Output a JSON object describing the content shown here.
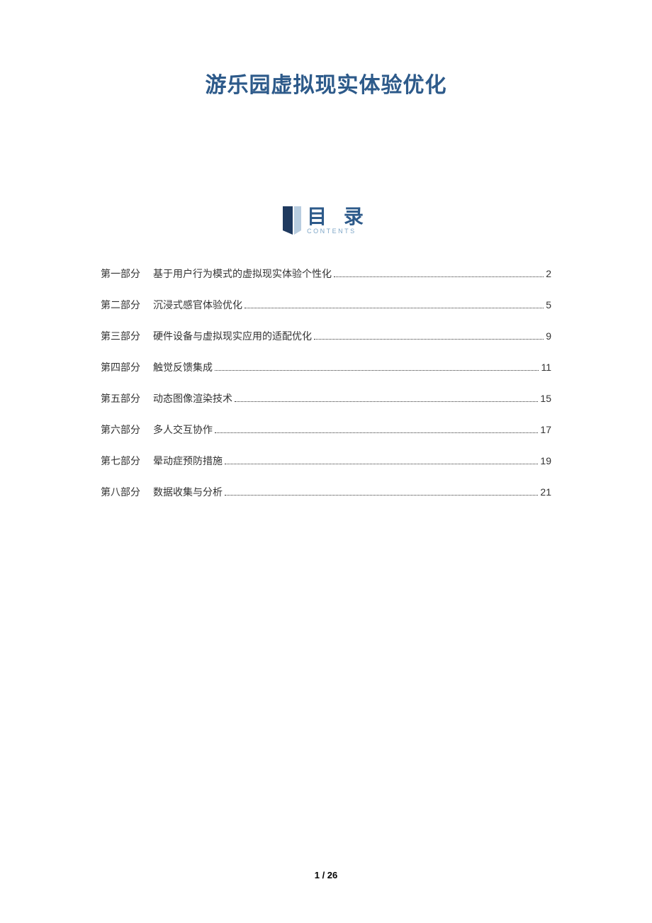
{
  "title": "游乐园虚拟现实体验优化",
  "contents": {
    "label": "目 录",
    "sublabel": "CONTENTS"
  },
  "toc": [
    {
      "part": "第一部分",
      "title": "基于用户行为模式的虚拟现实体验个性化",
      "page": "2"
    },
    {
      "part": "第二部分",
      "title": "沉浸式感官体验优化",
      "page": "5"
    },
    {
      "part": "第三部分",
      "title": "硬件设备与虚拟现实应用的适配优化",
      "page": "9"
    },
    {
      "part": "第四部分",
      "title": "触觉反馈集成",
      "page": "11"
    },
    {
      "part": "第五部分",
      "title": "动态图像渲染技术",
      "page": "15"
    },
    {
      "part": "第六部分",
      "title": "多人交互协作",
      "page": "17"
    },
    {
      "part": "第七部分",
      "title": "晕动症预防措施",
      "page": "19"
    },
    {
      "part": "第八部分",
      "title": "数据收集与分析",
      "page": "21"
    }
  ],
  "pageNumber": "1 / 26"
}
